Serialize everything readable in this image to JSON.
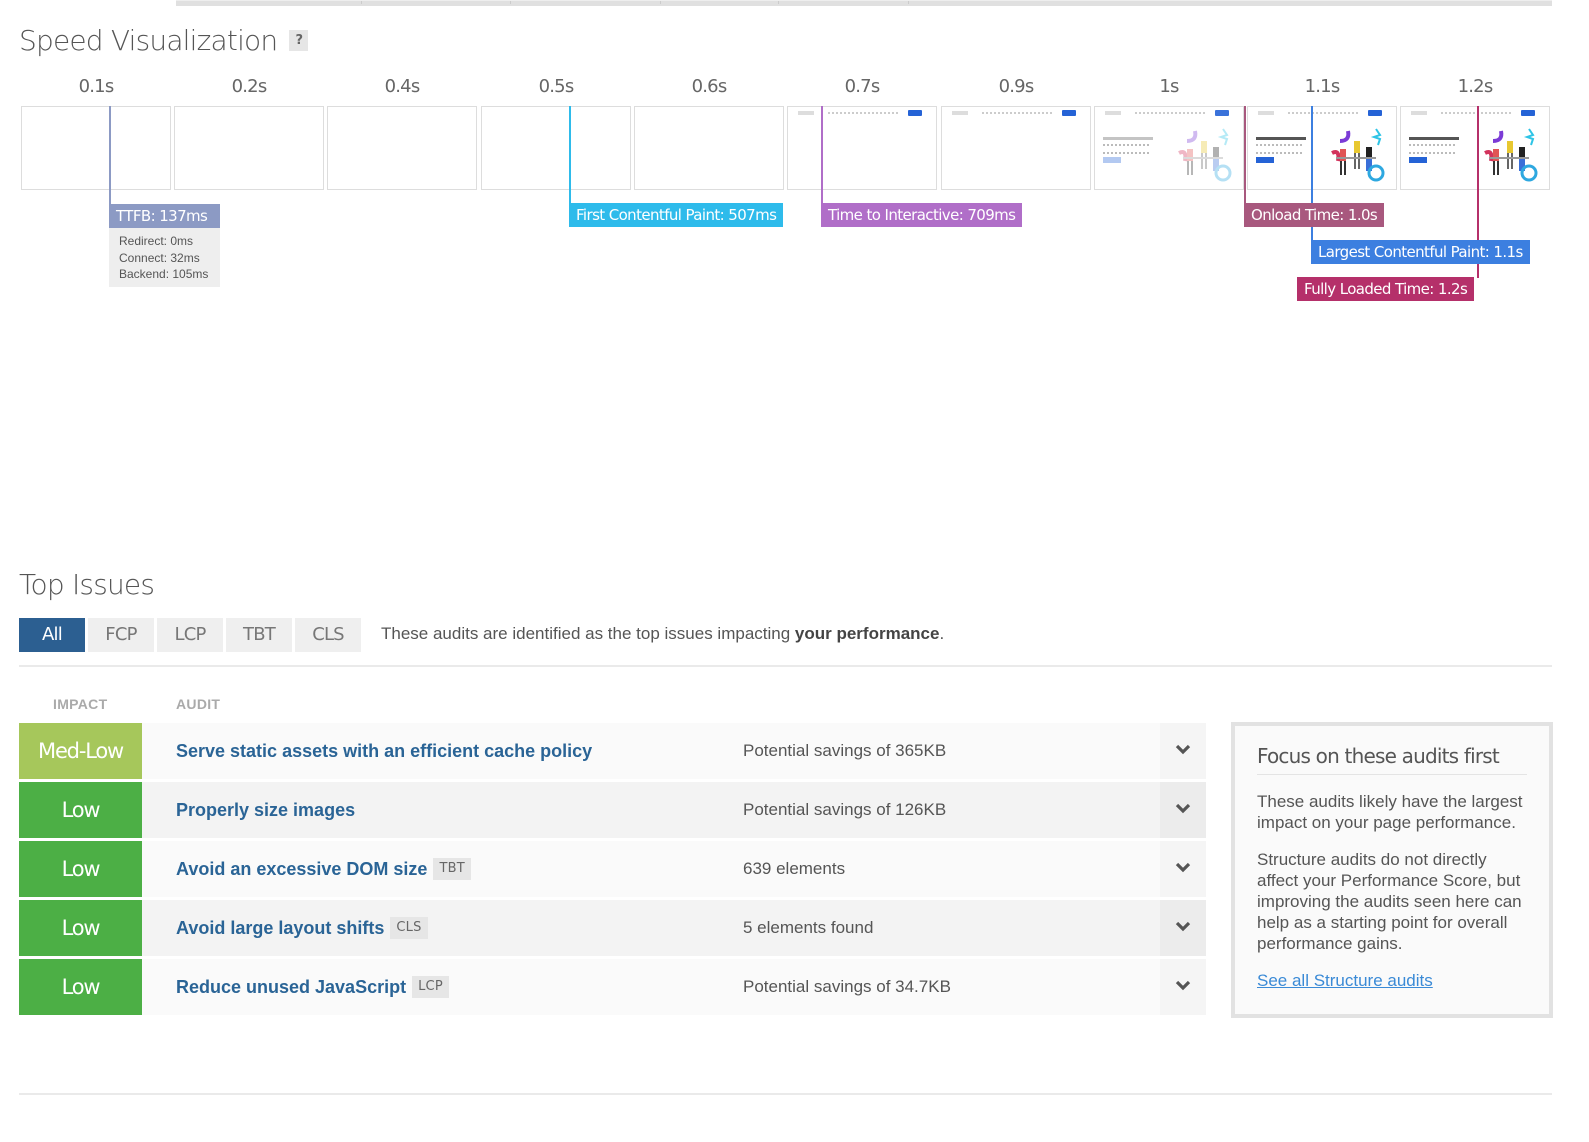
{
  "speed_visualization": {
    "title": "Speed Visualization",
    "help_label": "?",
    "timeline_ticks": [
      "0.1s",
      "0.2s",
      "0.4s",
      "0.5s",
      "0.6s",
      "0.7s",
      "0.9s",
      "1s",
      "1.1s",
      "1.2s"
    ],
    "frames": [
      {
        "time": "0.1s",
        "state": "blank"
      },
      {
        "time": "0.2s",
        "state": "blank"
      },
      {
        "time": "0.4s",
        "state": "blank"
      },
      {
        "time": "0.5s",
        "state": "blank"
      },
      {
        "time": "0.6s",
        "state": "blank"
      },
      {
        "time": "0.7s",
        "state": "header-only"
      },
      {
        "time": "0.9s",
        "state": "header-only"
      },
      {
        "time": "1s",
        "state": "faded-content"
      },
      {
        "time": "1.1s",
        "state": "full-content"
      },
      {
        "time": "1.2s",
        "state": "full-content"
      }
    ],
    "markers": {
      "ttfb": {
        "label": "TTFB: 137ms",
        "color": "#8c9ac4"
      },
      "fcp": {
        "label": "First Contentful Paint: 507ms",
        "color": "#2ebbeb"
      },
      "tti": {
        "label": "Time to Interactive: 709ms",
        "color": "#b06ec8"
      },
      "onload": {
        "label": "Onload Time: 1.0s",
        "color": "#a8587e"
      },
      "lcp": {
        "label": "Largest Contentful Paint: 1.1s",
        "color": "#3c7fe0"
      },
      "fully_loaded": {
        "label": "Fully Loaded Time: 1.2s",
        "color": "#b5306a"
      }
    },
    "ttfb_breakdown": {
      "redirect": "Redirect: 0ms",
      "connect": "Connect: 32ms",
      "backend": "Backend: 105ms"
    }
  },
  "top_issues": {
    "title": "Top Issues",
    "filters": [
      {
        "label": "All",
        "active": true
      },
      {
        "label": "FCP",
        "active": false
      },
      {
        "label": "LCP",
        "active": false
      },
      {
        "label": "TBT",
        "active": false
      },
      {
        "label": "CLS",
        "active": false
      }
    ],
    "note_prefix": "These audits are identified as the top issues impacting ",
    "note_bold": "your performance",
    "note_suffix": ".",
    "columns": {
      "impact": "IMPACT",
      "audit": "AUDIT"
    },
    "audits": [
      {
        "impact": "Med-Low",
        "impact_color": "#a6c75b",
        "name": "Serve static assets with an efficient cache policy",
        "tag": "",
        "value": "Potential savings of 365KB"
      },
      {
        "impact": "Low",
        "impact_color": "#4caf45",
        "name": "Properly size images",
        "tag": "",
        "value": "Potential savings of 126KB"
      },
      {
        "impact": "Low",
        "impact_color": "#4caf45",
        "name": "Avoid an excessive DOM size",
        "tag": "TBT",
        "value": "639 elements"
      },
      {
        "impact": "Low",
        "impact_color": "#4caf45",
        "name": "Avoid large layout shifts",
        "tag": "CLS",
        "value": "5 elements found"
      },
      {
        "impact": "Low",
        "impact_color": "#4caf45",
        "name": "Reduce unused JavaScript",
        "tag": "LCP",
        "value": "Potential savings of 34.7KB"
      }
    ],
    "focus_box": {
      "title": "Focus on these audits first",
      "paragraph1": "These audits likely have the largest impact on your page performance.",
      "paragraph2": "Structure audits do not directly affect your Performance Score, but improving the audits seen here can help as a starting point for overall performance gains.",
      "link": "See all Structure audits"
    }
  }
}
